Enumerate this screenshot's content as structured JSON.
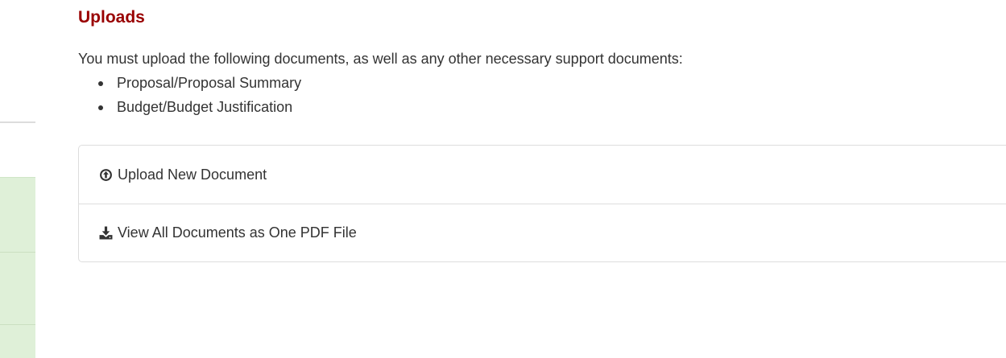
{
  "uploads": {
    "title": "Uploads",
    "intro": "You must upload the following documents, as well as any other necessary support documents:",
    "required_documents": [
      "Proposal/Proposal Summary",
      "Budget/Budget Justification"
    ],
    "actions": [
      {
        "label": "Upload New Document",
        "icon": "upload-circle-icon"
      },
      {
        "label": "View All Documents as One PDF File",
        "icon": "download-icon"
      }
    ]
  },
  "colors": {
    "title": "#990000",
    "text": "#333333",
    "border": "#dddddd",
    "sidebar_highlight": "#dff0d8"
  }
}
